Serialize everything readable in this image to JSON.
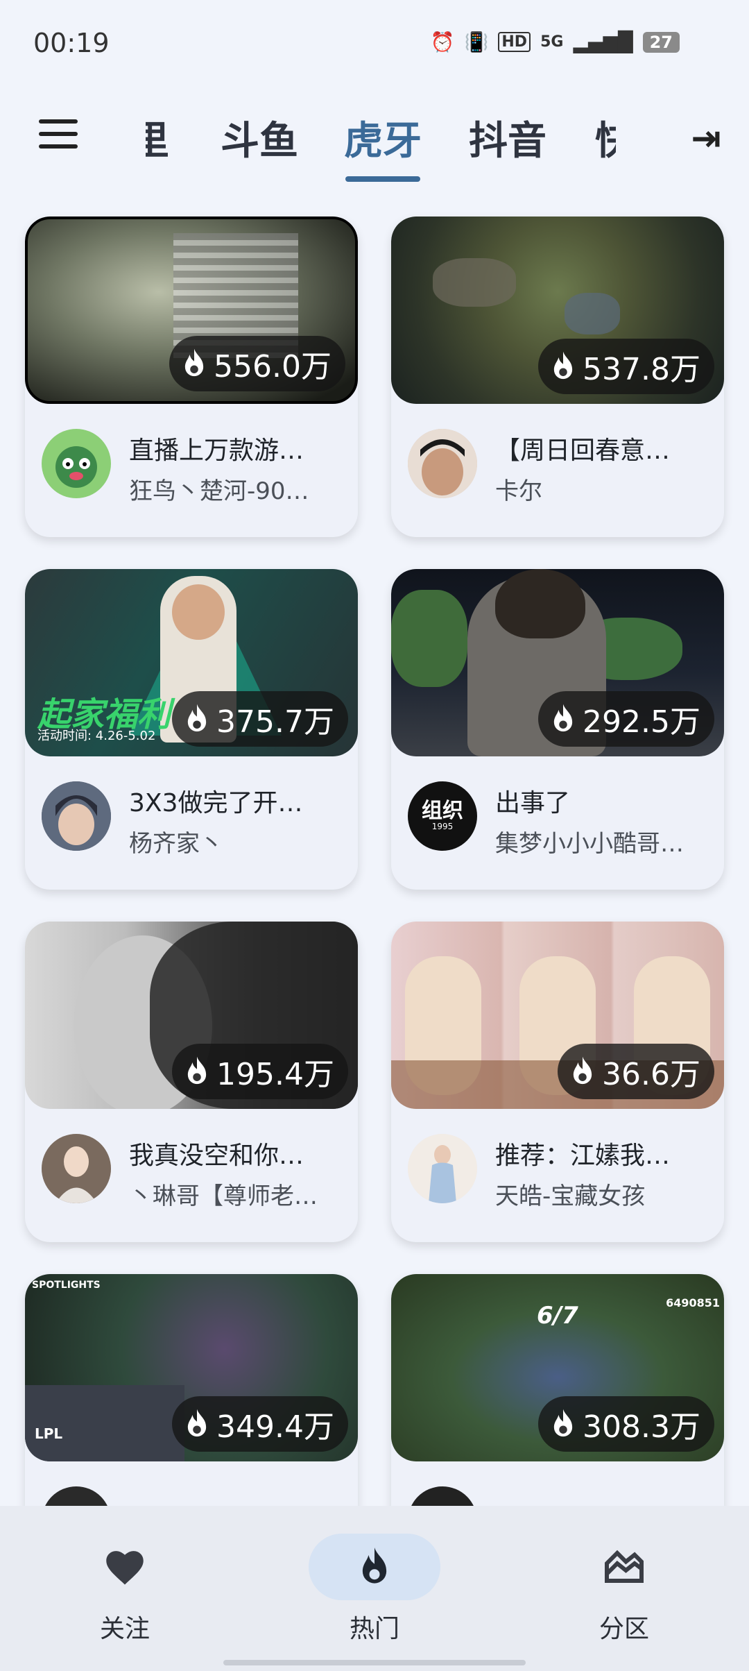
{
  "status": {
    "time": "00:19",
    "battery": "27",
    "network": "5G",
    "hd": "HD"
  },
  "nav": {
    "tabs": [
      {
        "label": "里",
        "partial": true
      },
      {
        "label": "斗鱼"
      },
      {
        "label": "虎牙",
        "active": true
      },
      {
        "label": "抖音"
      },
      {
        "label": "快",
        "partial": true
      }
    ]
  },
  "cards": [
    {
      "viewers": "556.0万",
      "title": "直播上万款游…",
      "user": "狂鸟丶楚河-90…"
    },
    {
      "viewers": "537.8万",
      "title": "【周日回春意…",
      "user": "卡尔"
    },
    {
      "viewers": "375.7万",
      "title": "3X3做完了开…",
      "user": "杨齐家丶",
      "overlay_text": "起家福利",
      "overlay_sub": "活动时间: 4.26-5.02"
    },
    {
      "viewers": "292.5万",
      "title": "出事了",
      "user": "集梦小小小酷哥…",
      "avatar_text": "组织",
      "avatar_sub": "1995"
    },
    {
      "viewers": "195.4万",
      "title": "我真没空和你…",
      "user": "丶琳哥【尊师老…"
    },
    {
      "viewers": "36.6万",
      "title": "推荐：江嫊我…",
      "user": "天皓-宝藏女孩"
    },
    {
      "viewers": "349.4万",
      "title": "",
      "user": "",
      "overlay_text": "SPOTLIGHTS",
      "overlay_sub": "LPL"
    },
    {
      "viewers": "308.3万",
      "title": "",
      "user": "",
      "overlay_text": "6/7",
      "overlay_sub": "6490851"
    }
  ],
  "bottom_nav": {
    "items": [
      {
        "label": "关注",
        "icon": "heart-icon"
      },
      {
        "label": "热门",
        "icon": "flame-icon",
        "active": true
      },
      {
        "label": "分区",
        "icon": "category-icon"
      }
    ]
  },
  "colors": {
    "accent": "#3b6a98",
    "background": "#f1f4fb",
    "active_pill": "#d6e3f4"
  }
}
